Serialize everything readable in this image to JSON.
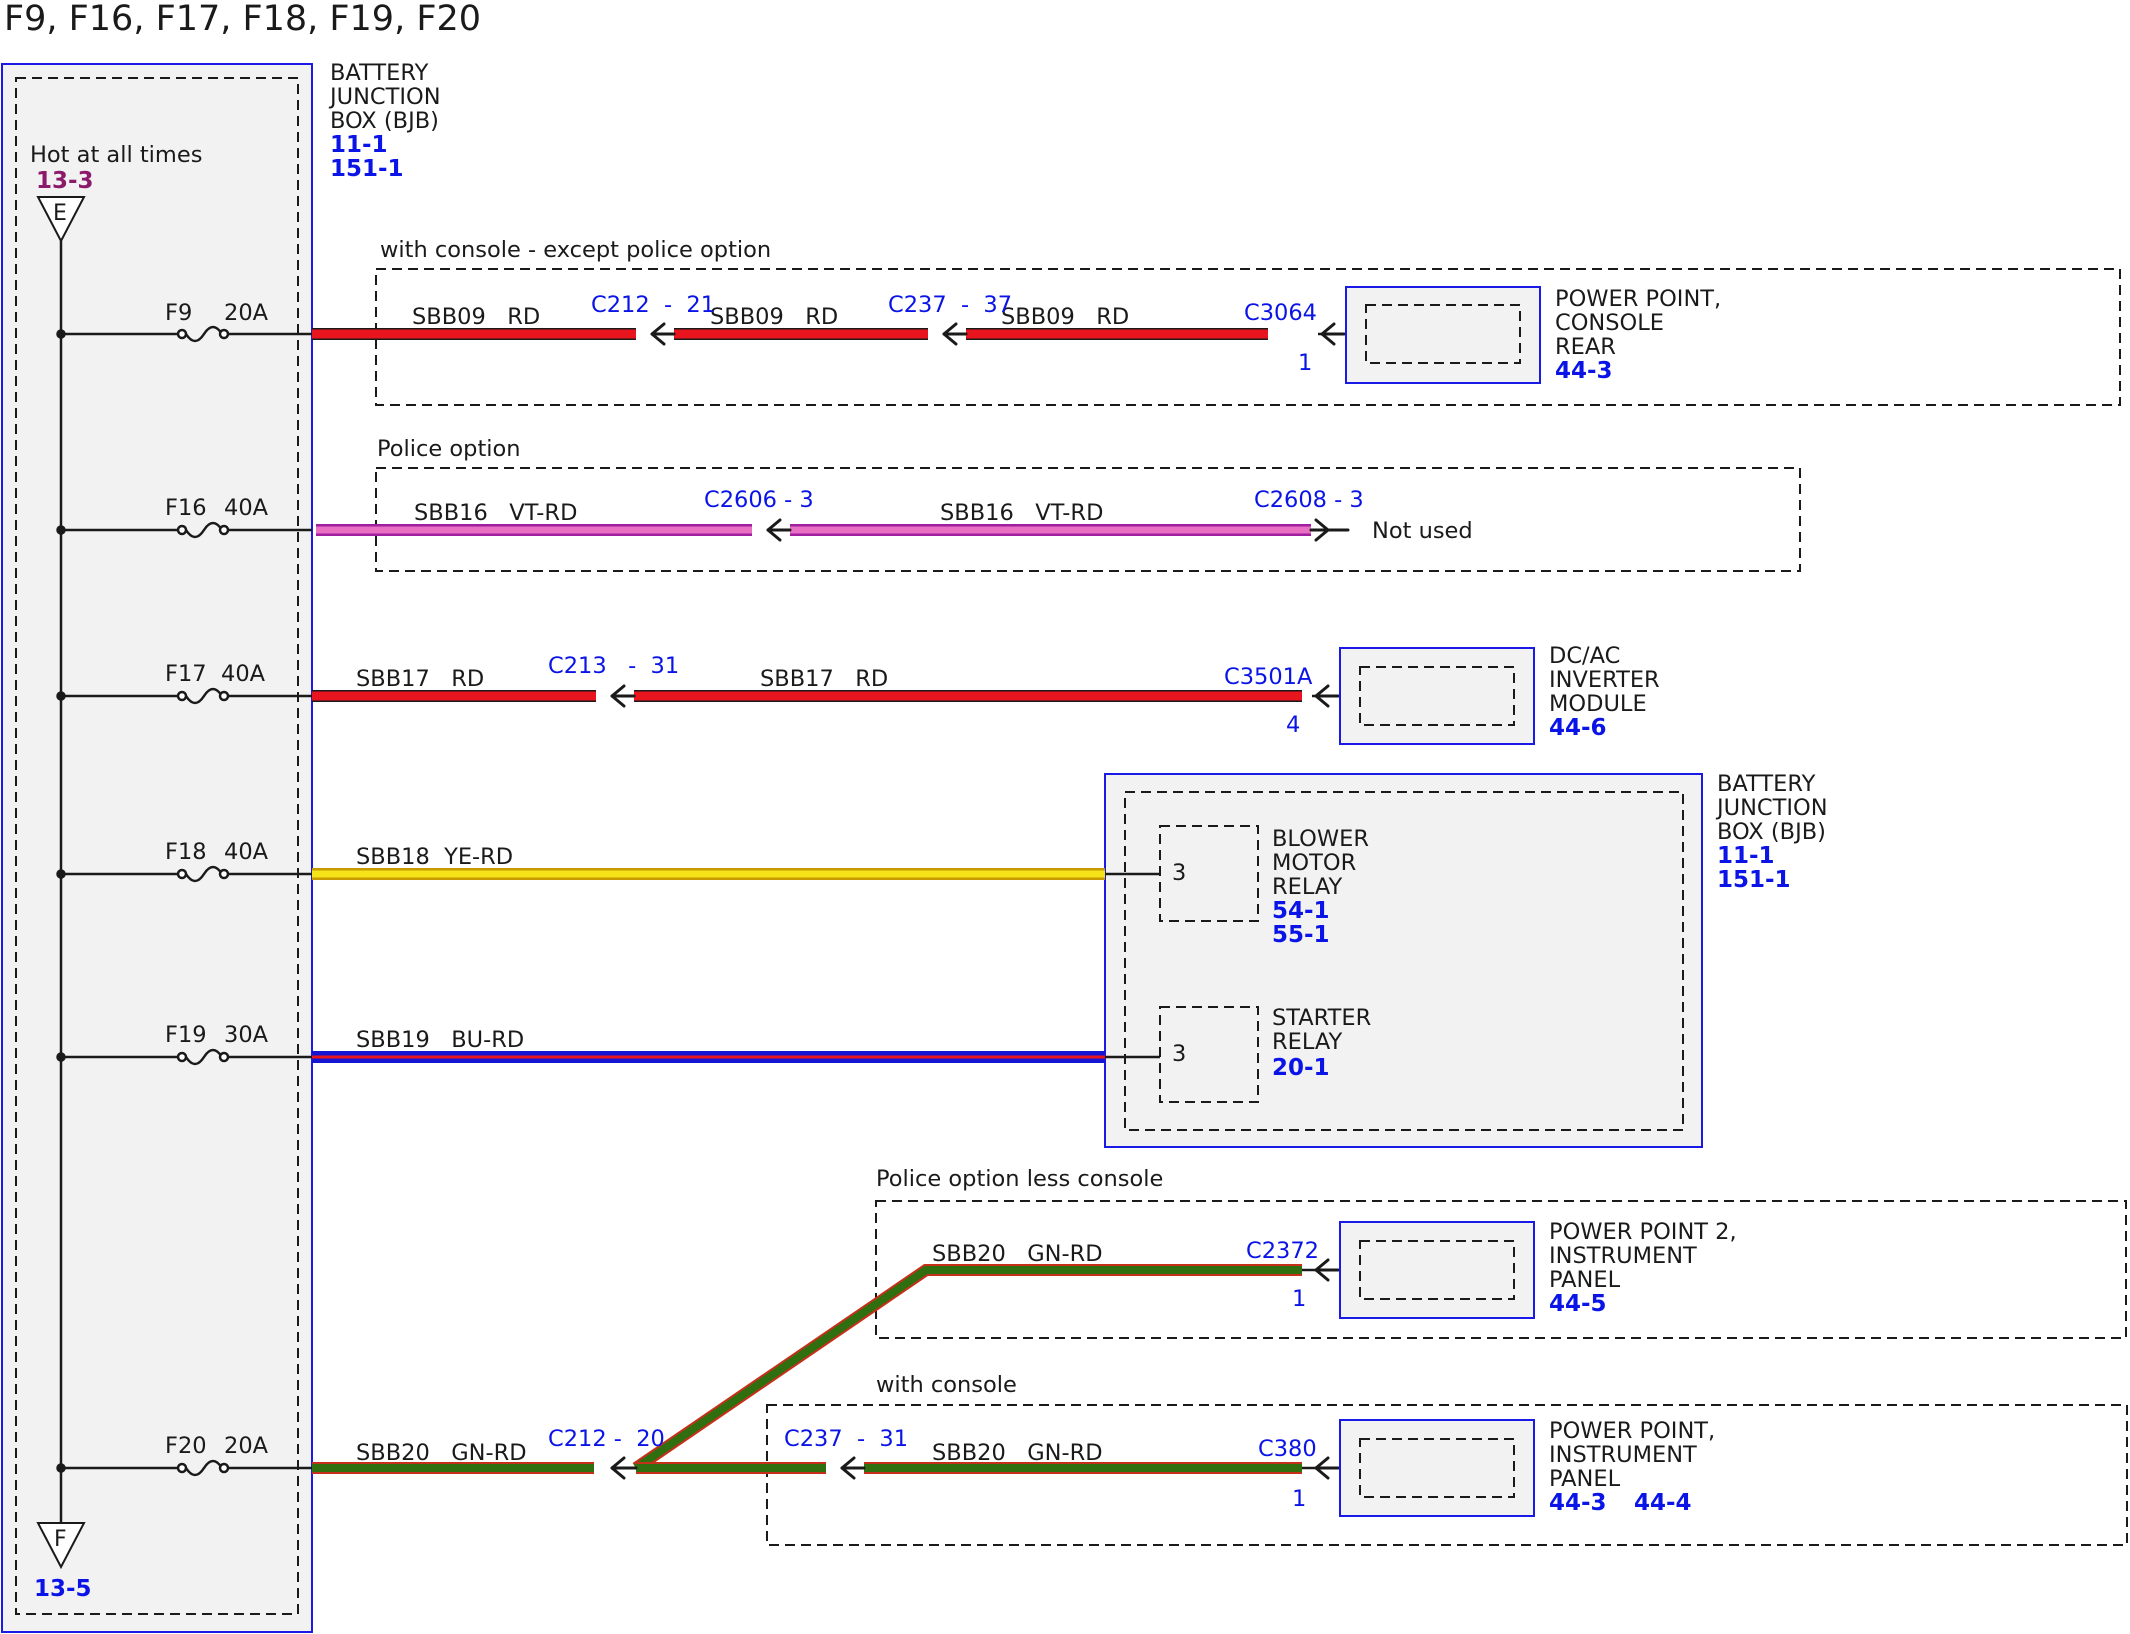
{
  "title": "F9, F16, F17, F18, F19, F20",
  "bjb_left": {
    "lines": [
      "BATTERY",
      "JUNCTION",
      "BOX (BJB)"
    ],
    "refs": [
      "11-1",
      "151-1"
    ]
  },
  "hot": {
    "label": "Hot at all times",
    "ref": "13-3",
    "top_symbol": "E",
    "bottom_symbol": "F",
    "bottom_ref": "13-5"
  },
  "fuses": [
    {
      "id": "F9",
      "rating": "20A"
    },
    {
      "id": "F16",
      "rating": "40A"
    },
    {
      "id": "F17",
      "rating": "40A"
    },
    {
      "id": "F18",
      "rating": "40A"
    },
    {
      "id": "F19",
      "rating": "30A"
    },
    {
      "id": "F20",
      "rating": "20A"
    }
  ],
  "options": {
    "f9": "with console - except police option",
    "f16": "Police option",
    "f20_upper": "Police option less console",
    "f20_lower": "with console"
  },
  "circuits": {
    "f9": [
      "SBB09   RD",
      "SBB09   RD",
      "SBB09   RD"
    ],
    "f16": [
      "SBB16   VT-RD",
      "SBB16   VT-RD"
    ],
    "f17": [
      "SBB17   RD",
      "SBB17   RD"
    ],
    "f18": [
      "SBB18  YE-RD"
    ],
    "f19": [
      "SBB19   BU-RD"
    ],
    "f20": [
      "SBB20   GN-RD",
      "SBB20   GN-RD",
      "SBB20   GN-RD"
    ]
  },
  "connectors": {
    "c212_21": "C212  -  21",
    "c237_37": "C237  -  37",
    "c3064": "C3064",
    "c3064_pin": "1",
    "c2606": "C2606 - 3",
    "c2608": "C2608 - 3",
    "c213": "C213   -  31",
    "c3501a": "C3501A",
    "c3501a_pin": "4",
    "c2372": "C2372",
    "c2372_pin": "1",
    "c212_20": "C212 -  20",
    "c237_31": "C237  -  31",
    "c380": "C380",
    "c380_pin": "1"
  },
  "not_used": "Not used",
  "components": {
    "pp_console_rear": {
      "lines": [
        "POWER POINT,",
        "CONSOLE",
        "REAR"
      ],
      "refs": [
        "44-3"
      ]
    },
    "inverter": {
      "lines": [
        "DC/AC",
        "INVERTER",
        "MODULE"
      ],
      "refs": [
        "44-6"
      ]
    },
    "bjb_right": {
      "lines": [
        "BATTERY",
        "JUNCTION",
        "BOX (BJB)"
      ],
      "refs": [
        "11-1",
        "151-1"
      ]
    },
    "blower": {
      "lines": [
        "BLOWER",
        "MOTOR",
        "RELAY"
      ],
      "refs": [
        "54-1",
        "55-1"
      ],
      "pin": "3"
    },
    "starter": {
      "lines": [
        "STARTER",
        "RELAY"
      ],
      "refs": [
        "20-1"
      ],
      "pin": "3"
    },
    "pp2_ip": {
      "lines": [
        "POWER POINT 2,",
        "INSTRUMENT",
        "PANEL"
      ],
      "refs": [
        "44-5"
      ]
    },
    "pp_ip": {
      "lines": [
        "POWER POINT,",
        "INSTRUMENT",
        "PANEL"
      ],
      "refs": [
        "44-3",
        "44-4"
      ]
    }
  },
  "colors": {
    "RD": "#e8141e",
    "VT-RD": [
      "#e96fc3",
      "#a01ea0"
    ],
    "YE-RD": [
      "#f5e41a",
      "#c79a00"
    ],
    "BU-RD": [
      "#1414d2",
      "#e8141e"
    ],
    "GN-RD": [
      "#2f6f10",
      "#c4301a"
    ],
    "box_outline": "#1a1ae6",
    "box_fill": "#f2f2f2"
  }
}
